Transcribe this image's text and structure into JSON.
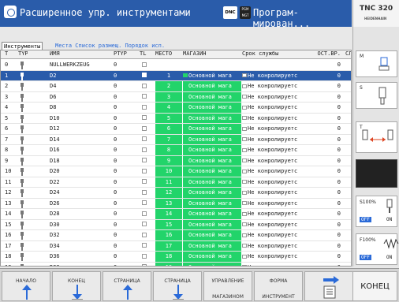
{
  "header": {
    "title": "Расширенное упр. инструментами",
    "dnc": "DNC",
    "pgm_badge": "PGM MGT",
    "mode": "Програм- мирован..."
  },
  "logo": {
    "model": "TNC 320",
    "brand": "HEIDENHAIN"
  },
  "tabs": [
    {
      "label": "Инструменты"
    },
    {
      "label": "Места Список размещ. Порядок исп."
    }
  ],
  "columns": [
    "T",
    "TYP",
    "ИМЯ",
    "PTYP",
    "TL",
    "МЕСТО",
    "МАГАЗИН",
    "Срок службы",
    "ОСТ.ВР.",
    "СЛ"
  ],
  "rows": [
    {
      "t": "0",
      "name": "NULLWERKZEUG",
      "ptyp": "0",
      "mesto": "",
      "mag": "",
      "srok": "",
      "ost": "0",
      "sel": false
    },
    {
      "t": "1",
      "name": "D2",
      "ptyp": "0",
      "mesto": "1",
      "mag": "Основной мага",
      "srok": "Не конролируетс",
      "ost": "0",
      "sel": true
    },
    {
      "t": "2",
      "name": "D4",
      "ptyp": "0",
      "mesto": "2",
      "mag": "Основной мага",
      "srok": "Не конролируетс",
      "ost": "0",
      "sel": false
    },
    {
      "t": "3",
      "name": "D6",
      "ptyp": "0",
      "mesto": "3",
      "mag": "Основной мага",
      "srok": "Не конролируетс",
      "ost": "0",
      "sel": false
    },
    {
      "t": "4",
      "name": "D8",
      "ptyp": "0",
      "mesto": "4",
      "mag": "Основной мага",
      "srok": "Не конролируетс",
      "ost": "0",
      "sel": false
    },
    {
      "t": "5",
      "name": "D10",
      "ptyp": "0",
      "mesto": "5",
      "mag": "Основной мага",
      "srok": "Не конролируетс",
      "ost": "0",
      "sel": false
    },
    {
      "t": "6",
      "name": "D12",
      "ptyp": "0",
      "mesto": "6",
      "mag": "Основной мага",
      "srok": "Не конролируетс",
      "ost": "0",
      "sel": false
    },
    {
      "t": "7",
      "name": "D14",
      "ptyp": "0",
      "mesto": "7",
      "mag": "Основной мага",
      "srok": "Не конролируетс",
      "ost": "0",
      "sel": false
    },
    {
      "t": "8",
      "name": "D16",
      "ptyp": "0",
      "mesto": "8",
      "mag": "Основной мага",
      "srok": "Не конролируетс",
      "ost": "0",
      "sel": false
    },
    {
      "t": "9",
      "name": "D18",
      "ptyp": "0",
      "mesto": "9",
      "mag": "Основной мага",
      "srok": "Не конролируетс",
      "ost": "0",
      "sel": false
    },
    {
      "t": "10",
      "name": "D20",
      "ptyp": "0",
      "mesto": "10",
      "mag": "Основной мага",
      "srok": "Не конролируетс",
      "ost": "0",
      "sel": false
    },
    {
      "t": "11",
      "name": "D22",
      "ptyp": "0",
      "mesto": "11",
      "mag": "Основной мага",
      "srok": "Не конролируетс",
      "ost": "0",
      "sel": false
    },
    {
      "t": "12",
      "name": "D24",
      "ptyp": "0",
      "mesto": "12",
      "mag": "Основной мага",
      "srok": "Не конролируетс",
      "ost": "0",
      "sel": false
    },
    {
      "t": "13",
      "name": "D26",
      "ptyp": "0",
      "mesto": "13",
      "mag": "Основной мага",
      "srok": "Не конролируетс",
      "ost": "0",
      "sel": false
    },
    {
      "t": "14",
      "name": "D28",
      "ptyp": "0",
      "mesto": "14",
      "mag": "Основной мага",
      "srok": "Не конролируетс",
      "ost": "0",
      "sel": false
    },
    {
      "t": "15",
      "name": "D30",
      "ptyp": "0",
      "mesto": "15",
      "mag": "Основной мага",
      "srok": "Не конролируетс",
      "ost": "0",
      "sel": false
    },
    {
      "t": "16",
      "name": "D32",
      "ptyp": "0",
      "mesto": "16",
      "mag": "Основной мага",
      "srok": "Не конролируетс",
      "ost": "0",
      "sel": false
    },
    {
      "t": "17",
      "name": "D34",
      "ptyp": "0",
      "mesto": "17",
      "mag": "Основной мага",
      "srok": "Не конролируетс",
      "ost": "0",
      "sel": false
    },
    {
      "t": "18",
      "name": "D36",
      "ptyp": "0",
      "mesto": "18",
      "mag": "Основной мага",
      "srok": "Не конролируетс",
      "ost": "0",
      "sel": false
    },
    {
      "t": "19",
      "name": "D38",
      "ptyp": "0",
      "mesto": "19",
      "mag": "Основной мага",
      "srok": "Не конролируетс",
      "ost": "0",
      "sel": false
    }
  ],
  "sidebar": {
    "m": "M",
    "s": "S",
    "t": "T",
    "s_override": "S100%",
    "s_off": "OFF",
    "s_on": "ON",
    "f_override": "F100%",
    "f_off": "OFF",
    "f_on": "ON"
  },
  "softkeys": [
    {
      "line1": "НАЧАЛО",
      "line2": "",
      "arrow": "up"
    },
    {
      "line1": "КОНЕЦ",
      "line2": "",
      "arrow": "down"
    },
    {
      "line1": "СТРАНИЦА",
      "line2": "",
      "arrow": "up"
    },
    {
      "line1": "СТРАНИЦА",
      "line2": "",
      "arrow": "down"
    },
    {
      "line1": "УПРАВЛЕНИЕ",
      "line2": "МАГАЗИНОМ",
      "arrow": ""
    },
    {
      "line1": "ФОРМА",
      "line2": "ИНСТРУМЕНТ",
      "arrow": ""
    },
    {
      "line1": "",
      "line2": "",
      "arrow": "right-doc"
    }
  ],
  "end_key": "КОНЕЦ",
  "colors": {
    "title_bg": "#2a5caa",
    "selection": "#2a5caa",
    "magazine_green": "#22d46a",
    "accent": "#2a6ad8"
  }
}
